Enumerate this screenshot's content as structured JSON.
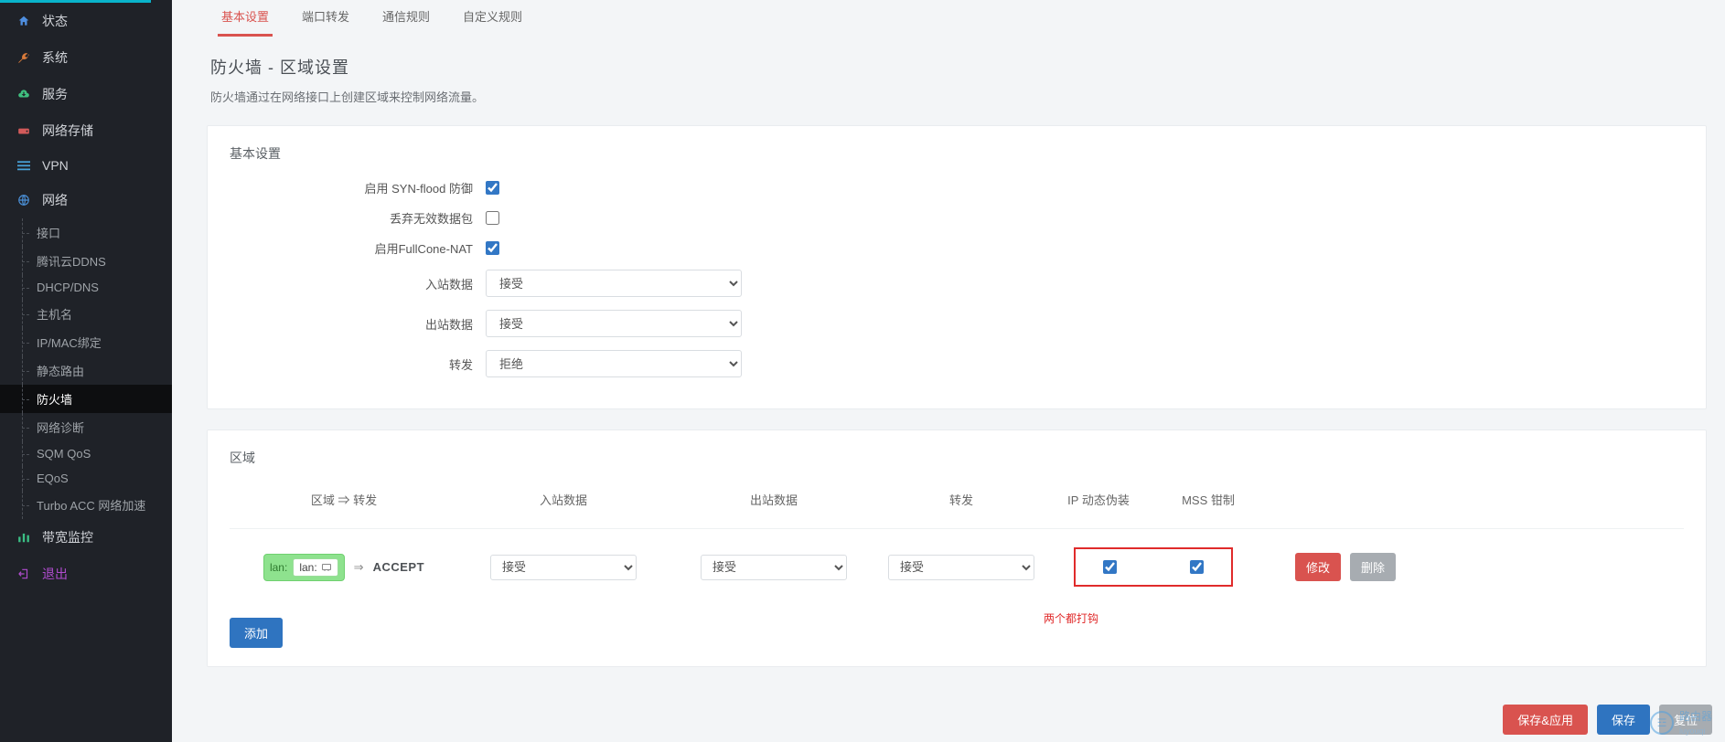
{
  "sidebar": {
    "main": [
      {
        "icon": "home",
        "label": "状态"
      },
      {
        "icon": "wrench",
        "label": "系统"
      },
      {
        "icon": "cloud",
        "label": "服务"
      },
      {
        "icon": "drive",
        "label": "网络存储"
      },
      {
        "icon": "bars",
        "label": "VPN"
      },
      {
        "icon": "globe",
        "label": "网络"
      }
    ],
    "network_sub": [
      "接口",
      "腾讯云DDNS",
      "DHCP/DNS",
      "主机名",
      "IP/MAC绑定",
      "静态路由",
      "防火墙",
      "网络诊断",
      "SQM QoS",
      "EQoS",
      "Turbo ACC 网络加速"
    ],
    "active_sub": "防火墙",
    "bandwidth": {
      "label": "带宽监控"
    },
    "logout": {
      "label": "退出"
    }
  },
  "tabs": {
    "items": [
      "基本设置",
      "端口转发",
      "通信规则",
      "自定义规则"
    ],
    "active": "基本设置"
  },
  "page": {
    "title": "防火墙 - 区域设置",
    "subtitle": "防火墙通过在网络接口上创建区域来控制网络流量。"
  },
  "basic_card": {
    "title": "基本设置",
    "rows": {
      "syn_flood": {
        "label": "启用 SYN-flood 防御",
        "checked": true
      },
      "drop_inv": {
        "label": "丢弃无效数据包",
        "checked": false
      },
      "fullcone": {
        "label": "启用FullCone-NAT",
        "checked": true
      },
      "input": {
        "label": "入站数据",
        "value": "接受"
      },
      "output": {
        "label": "出站数据",
        "value": "接受"
      },
      "forward": {
        "label": "转发",
        "value": "拒绝"
      }
    }
  },
  "zone_card": {
    "title": "区域",
    "headers": {
      "zone_forward": "区域 ⇒ 转发",
      "input": "入站数据",
      "output": "出站数据",
      "forward": "转发",
      "masq": "IP 动态伪装",
      "mss": "MSS 钳制"
    },
    "row": {
      "zone_name": "lan:",
      "zone_if": "lan:",
      "action": "ACCEPT",
      "input": "接受",
      "output": "接受",
      "forward": "接受",
      "masq": true,
      "mss": true
    },
    "annotation": "两个都打钩",
    "add_label": "添加",
    "edit_label": "修改",
    "delete_label": "删除"
  },
  "footer": {
    "save_apply": "保存&应用",
    "save": "保存",
    "reset": "复位"
  },
  "watermark": {
    "text": "路由器",
    "sub": "luyouqi"
  }
}
